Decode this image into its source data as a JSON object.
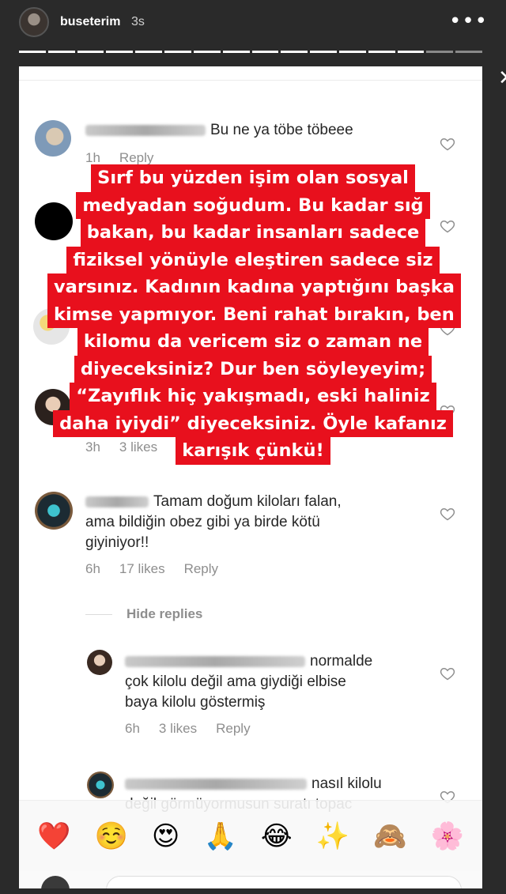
{
  "story": {
    "username": "buseterim",
    "time": "3s",
    "menu_icon": "more-dots-icon",
    "close_icon": "close-icon",
    "progress_segments_total": 16,
    "progress_segments_viewed": 14
  },
  "comments": [
    {
      "text": "Bu ne ya töbe töbeee",
      "meta_time": "1h",
      "meta_reply": "Reply"
    },
    {
      "meta_time": "3h",
      "meta_likes": "3 likes"
    },
    {
      "text_line1": "Tamam doğum kiloları falan,",
      "text_line2": "ama bildiğin obez gibi ya birde kötü",
      "text_line3": "giyiniyor!!",
      "meta_time": "6h",
      "meta_likes": "17 likes",
      "meta_reply": "Reply"
    }
  ],
  "hide_replies": "Hide replies",
  "replies": [
    {
      "text_line1": "normalde",
      "text_line2": "çok kilolu değil ama giydiği elbise",
      "text_line3": "baya kilolu göstermiş",
      "meta_time": "6h",
      "meta_likes": "3 likes",
      "meta_reply": "Reply"
    },
    {
      "text_line1": "nasıl kilolu",
      "text_line2": "değil görmüyormusun suratı topac"
    }
  ],
  "overlay_lines": [
    "Sırf bu yüzden işim olan sosyal",
    "medyadan soğudum. Bu kadar sığ",
    "bakan, bu kadar insanları sadece",
    "fiziksel yönüyle eleştiren sadece siz",
    "varsınız. Kadının kadına yaptığını başka",
    "kimse yapmıyor. Beni rahat bırakın, ben",
    "kilomu da vericem siz o zaman ne",
    "diyeceksiniz? Dur ben söyleyeyim;",
    "“Zayıflık hiç yakışmadı, eski haliniz",
    "daha iyiydi” diyeceksiniz. Öyle kafanız",
    "karışık çünkü!"
  ],
  "emojis": [
    "❤️",
    "☺️",
    "😍",
    "🙏",
    "😂",
    "✨",
    "🙈",
    "🌸"
  ],
  "colors": {
    "overlay_bg": "#e8101d",
    "meta_text": "#8e8e8e",
    "text": "#262626"
  }
}
